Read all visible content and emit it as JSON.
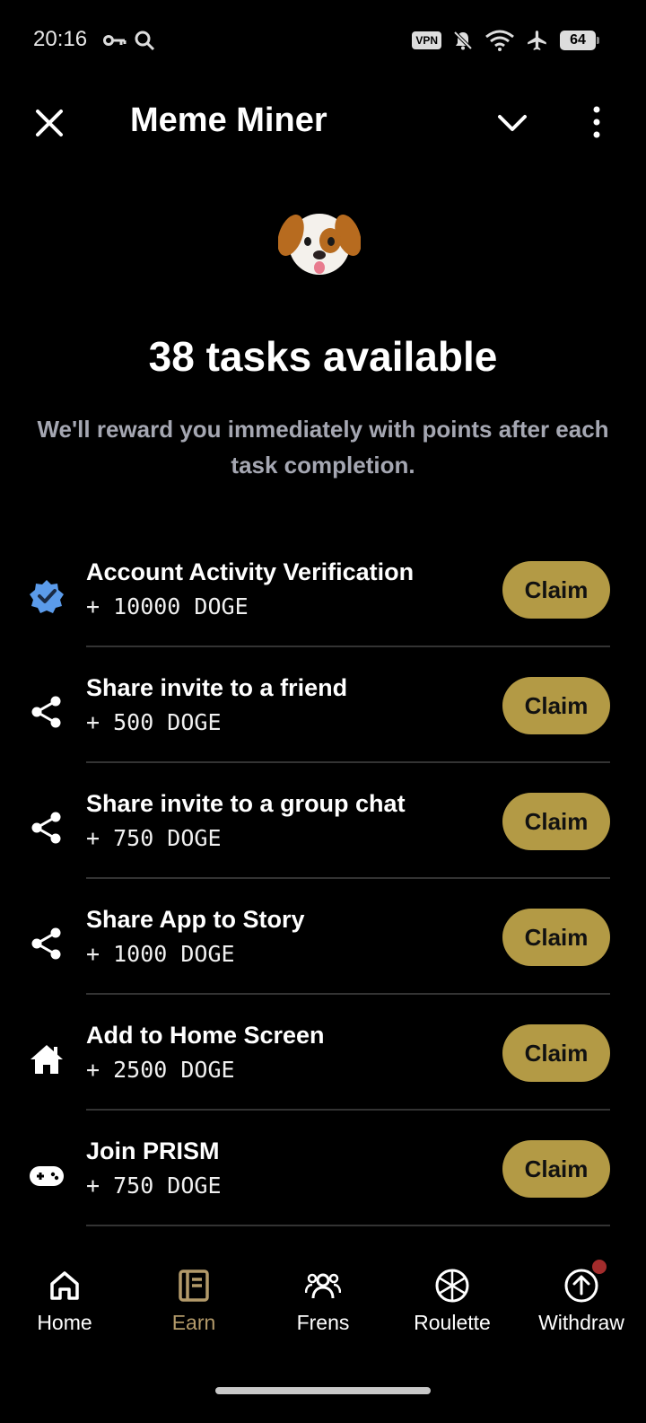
{
  "status_bar": {
    "time": "20:16",
    "vpn": "VPN",
    "battery": "64"
  },
  "header": {
    "title": "Meme Miner"
  },
  "main": {
    "title": "38 tasks available",
    "subtitle": "We'll reward you immediately with points after each task completion."
  },
  "tasks": [
    {
      "icon": "verified-badge-icon",
      "title": "Account Activity Verification",
      "reward": "+ 10000 DOGE",
      "button": "Claim"
    },
    {
      "icon": "share-icon",
      "title": "Share invite to a friend",
      "reward": "+ 500 DOGE",
      "button": "Claim"
    },
    {
      "icon": "share-icon",
      "title": "Share invite to a group chat",
      "reward": "+ 750 DOGE",
      "button": "Claim"
    },
    {
      "icon": "share-icon",
      "title": "Share App to Story",
      "reward": "+ 1000 DOGE",
      "button": "Claim"
    },
    {
      "icon": "home-icon",
      "title": "Add to Home Screen",
      "reward": "+ 2500 DOGE",
      "button": "Claim"
    },
    {
      "icon": "gamepad-icon",
      "title": "Join PRISM",
      "reward": "+ 750 DOGE",
      "button": "Claim"
    }
  ],
  "nav": {
    "items": [
      {
        "label": "Home",
        "icon": "home-outline-icon"
      },
      {
        "label": "Earn",
        "icon": "earn-icon"
      },
      {
        "label": "Frens",
        "icon": "frens-icon"
      },
      {
        "label": "Roulette",
        "icon": "roulette-icon"
      },
      {
        "label": "Withdraw",
        "icon": "withdraw-icon"
      }
    ]
  },
  "colors": {
    "accent": "#b39a45",
    "active_nav": "#b39a6a",
    "subtitle": "#a5a7b2",
    "notification_dot": "#a32c2c"
  }
}
